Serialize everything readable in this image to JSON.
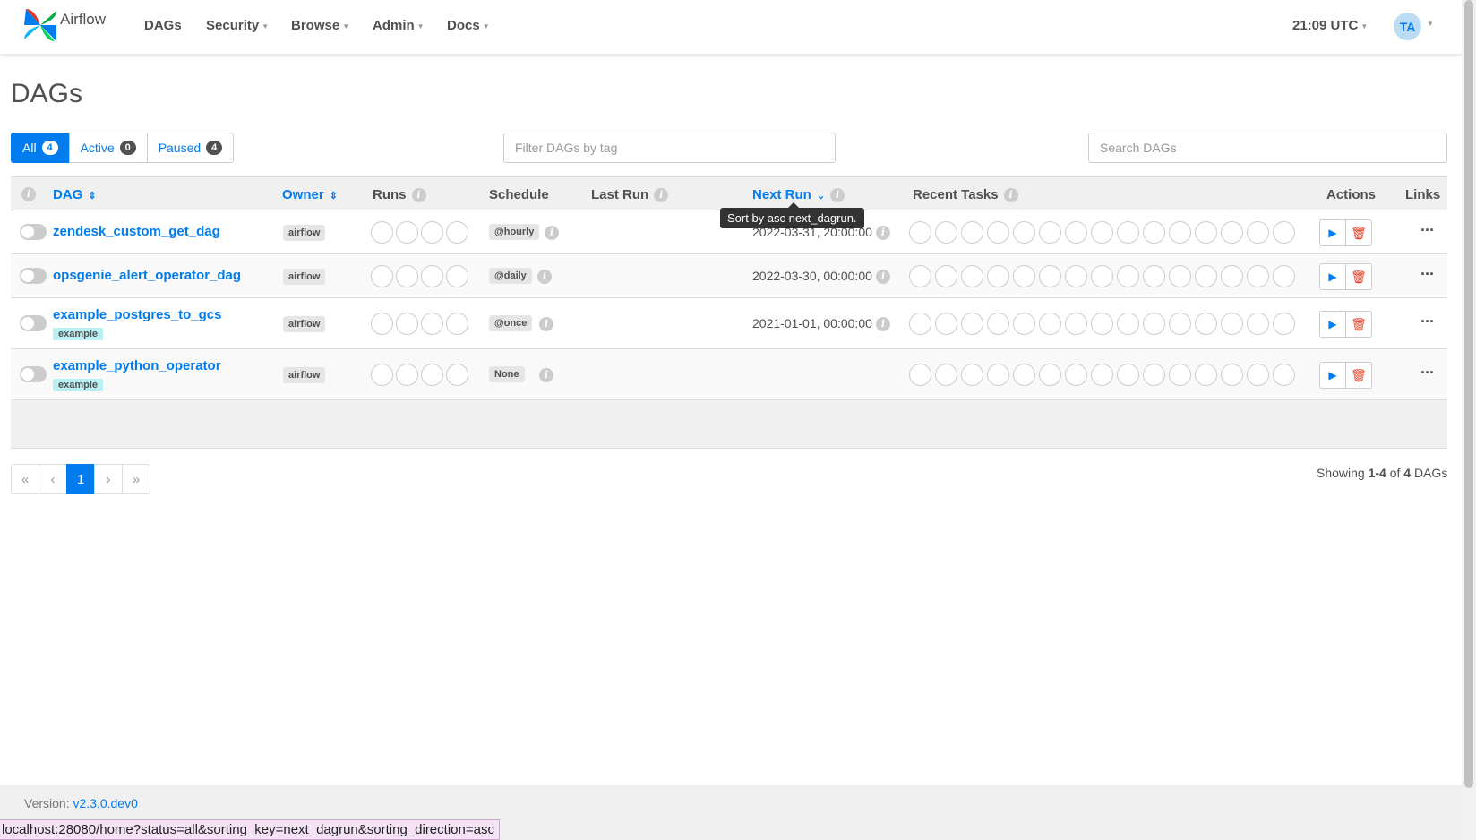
{
  "nav": {
    "logo_text": "Airflow",
    "items": [
      {
        "label": "DAGs",
        "dropdown": false
      },
      {
        "label": "Security",
        "dropdown": true
      },
      {
        "label": "Browse",
        "dropdown": true
      },
      {
        "label": "Admin",
        "dropdown": true
      },
      {
        "label": "Docs",
        "dropdown": true
      }
    ],
    "time": "21:09 UTC",
    "avatar_initials": "TA"
  },
  "page_title": "DAGs",
  "status_filter": {
    "all": {
      "label": "All",
      "count": "4"
    },
    "active": {
      "label": "Active",
      "count": "0"
    },
    "paused": {
      "label": "Paused",
      "count": "4"
    }
  },
  "tag_filter_placeholder": "Filter DAGs by tag",
  "search_placeholder": "Search DAGs",
  "table": {
    "headers": {
      "dag": "DAG",
      "owner": "Owner",
      "runs": "Runs",
      "schedule": "Schedule",
      "last_run": "Last Run",
      "next_run": "Next Run",
      "recent_tasks": "Recent Tasks",
      "actions": "Actions",
      "links": "Links"
    },
    "tooltip": "Sort by asc next_dagrun.",
    "rows": [
      {
        "dag_id": "zendesk_custom_get_dag",
        "tag": "",
        "owner": "airflow",
        "schedule": "@hourly",
        "next_run": "2022-03-31, 20:00:00"
      },
      {
        "dag_id": "opsgenie_alert_operator_dag",
        "tag": "",
        "owner": "airflow",
        "schedule": "@daily",
        "next_run": "2022-03-30, 00:00:00"
      },
      {
        "dag_id": "example_postgres_to_gcs",
        "tag": "example",
        "owner": "airflow",
        "schedule": "@once",
        "next_run": "2021-01-01, 00:00:00"
      },
      {
        "dag_id": "example_python_operator",
        "tag": "example",
        "owner": "airflow",
        "schedule": "None",
        "next_run": ""
      }
    ]
  },
  "pagination": {
    "first": "«",
    "prev": "‹",
    "current": "1",
    "next": "›",
    "last": "»"
  },
  "showing": {
    "prefix": "Showing ",
    "range": "1-4",
    "of": " of ",
    "total": "4",
    "suffix": " DAGs"
  },
  "footer": {
    "version_label": "Version: ",
    "version": "v2.3.0.dev0"
  },
  "status_bar_url": "localhost:28080/home?status=all&sorting_key=next_dagrun&sorting_direction=asc",
  "colors": {
    "accent": "#017cee",
    "tag": "#b9f0f4",
    "delete": "#e43921"
  }
}
